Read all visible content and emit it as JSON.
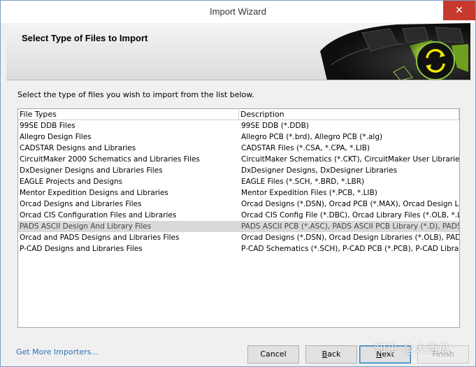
{
  "window": {
    "title": "Import Wizard",
    "close_glyph": "✕"
  },
  "header": {
    "title": "Select Type of Files to Import",
    "graphic_icon": "refresh-icon"
  },
  "content": {
    "instruction": "Select the type of files you wish to import from the list below."
  },
  "list": {
    "columns": [
      "File Types",
      "Description"
    ],
    "rows": [
      {
        "type": "99SE DDB Files",
        "description": "99SE DDB (*.DDB)"
      },
      {
        "type": "Allegro Design Files",
        "description": "Allegro PCB (*.brd), Allegro PCB (*.alg)"
      },
      {
        "type": "CADSTAR Designs and Libraries",
        "description": "CADSTAR Files (*.CSA, *.CPA, *.LIB)"
      },
      {
        "type": "CircuitMaker 2000 Schematics and Libraries Files",
        "description": "CircuitMaker Schematics (*.CKT), CircuitMaker User Libraries (*"
      },
      {
        "type": "DxDesigner Designs and Libraries Files",
        "description": "DxDesigner Designs, DxDesigner Libraries"
      },
      {
        "type": "EAGLE Projects and Designs",
        "description": "EAGLE Files (*.SCH, *.BRD, *.LBR)"
      },
      {
        "type": "Mentor Expedition Designs and Libraries",
        "description": "Mentor Expedition Files (*.PCB, *.LIB)"
      },
      {
        "type": "Orcad Designs and Libraries Files",
        "description": "Orcad Designs (*.DSN), Orcad PCB (*.MAX), Orcad Design Libr"
      },
      {
        "type": "Orcad CIS Configuration Files and Libraries",
        "description": "Orcad CIS Config File (*.DBC), Orcad Library Files (*.OLB, *.LLB"
      },
      {
        "type": "PADS ASCII Design And Library Files",
        "description": "PADS ASCII PCB (*.ASC), PADS ASCII PCB Library (*.D), PADS ASC"
      },
      {
        "type": "Orcad and PADS Designs and Libraries Files",
        "description": "Orcad Designs (*.DSN), Orcad Design Libraries (*.OLB), PADS A"
      },
      {
        "type": "P-CAD Designs and Libraries Files",
        "description": "P-CAD Schematics (*.SCH), P-CAD PCB (*.PCB), P-CAD Libraries"
      }
    ],
    "selected_index": 9
  },
  "footer": {
    "link": "Get More Importers...",
    "cancel": "Cancel",
    "back_underline": "B",
    "back_rest": "ack",
    "next_underline": "N",
    "next_rest": "ext",
    "finish": "Finish"
  },
  "watermark": "知乎 @大西瓜",
  "colors": {
    "close_button": "#c7392c",
    "link": "#2d6db5",
    "selected_row": "#d9d9d9",
    "accent_green": "#a6e22e"
  }
}
